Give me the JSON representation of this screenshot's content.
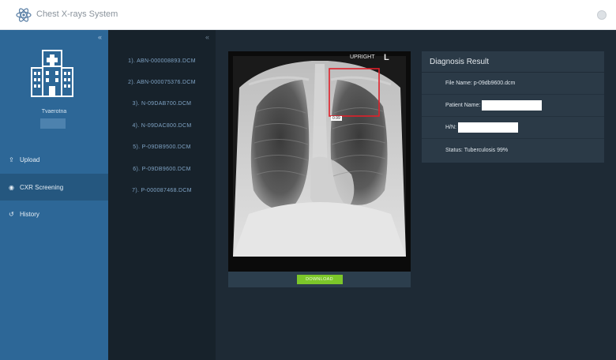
{
  "app": {
    "title": "Chest X-rays System",
    "logo_icon": "atom-icon"
  },
  "sidebar": {
    "collapse_glyph": "«",
    "user_name": "Tvaerotna",
    "nav": [
      {
        "label": "Upload",
        "icon": "upload-icon",
        "active": false
      },
      {
        "label": "CXR Screening",
        "icon": "eye-icon",
        "active": true
      },
      {
        "label": "History",
        "icon": "history-icon",
        "active": false
      }
    ]
  },
  "file_list": {
    "collapse_glyph": "«",
    "files": [
      "1). ABN-000008893.DCM",
      "2). ABN-000075376.DCM",
      "3). N-09DAB700.DCM",
      "4). N-09DAC800.DCM",
      "5). P-09DB9500.DCM",
      "6). P-09DB9600.DCM",
      "7). P-000087468.DCM"
    ]
  },
  "viewer": {
    "orientation_label": "UPRIGHT",
    "side_marker": "L",
    "detection_label": "0.99",
    "download_label": "DOWNLOAD"
  },
  "diagnosis": {
    "title": "Diagnosis Result",
    "file_name_label": "File Name:",
    "file_name": "p-09db9600.dcm",
    "patient_name_label": "Patient Name:",
    "hn_label": "H/N:",
    "status_label": "Status:",
    "status_value": "Tuberculosis 99%"
  },
  "colors": {
    "sidebar": "#2d6797",
    "sidebar_active": "#25577f",
    "file_list_bg": "#17222b",
    "main_bg": "#1e2a35",
    "panel_bg": "#2b3a47",
    "detection_box": "#e0202a",
    "download_button": "#7cc62a"
  }
}
